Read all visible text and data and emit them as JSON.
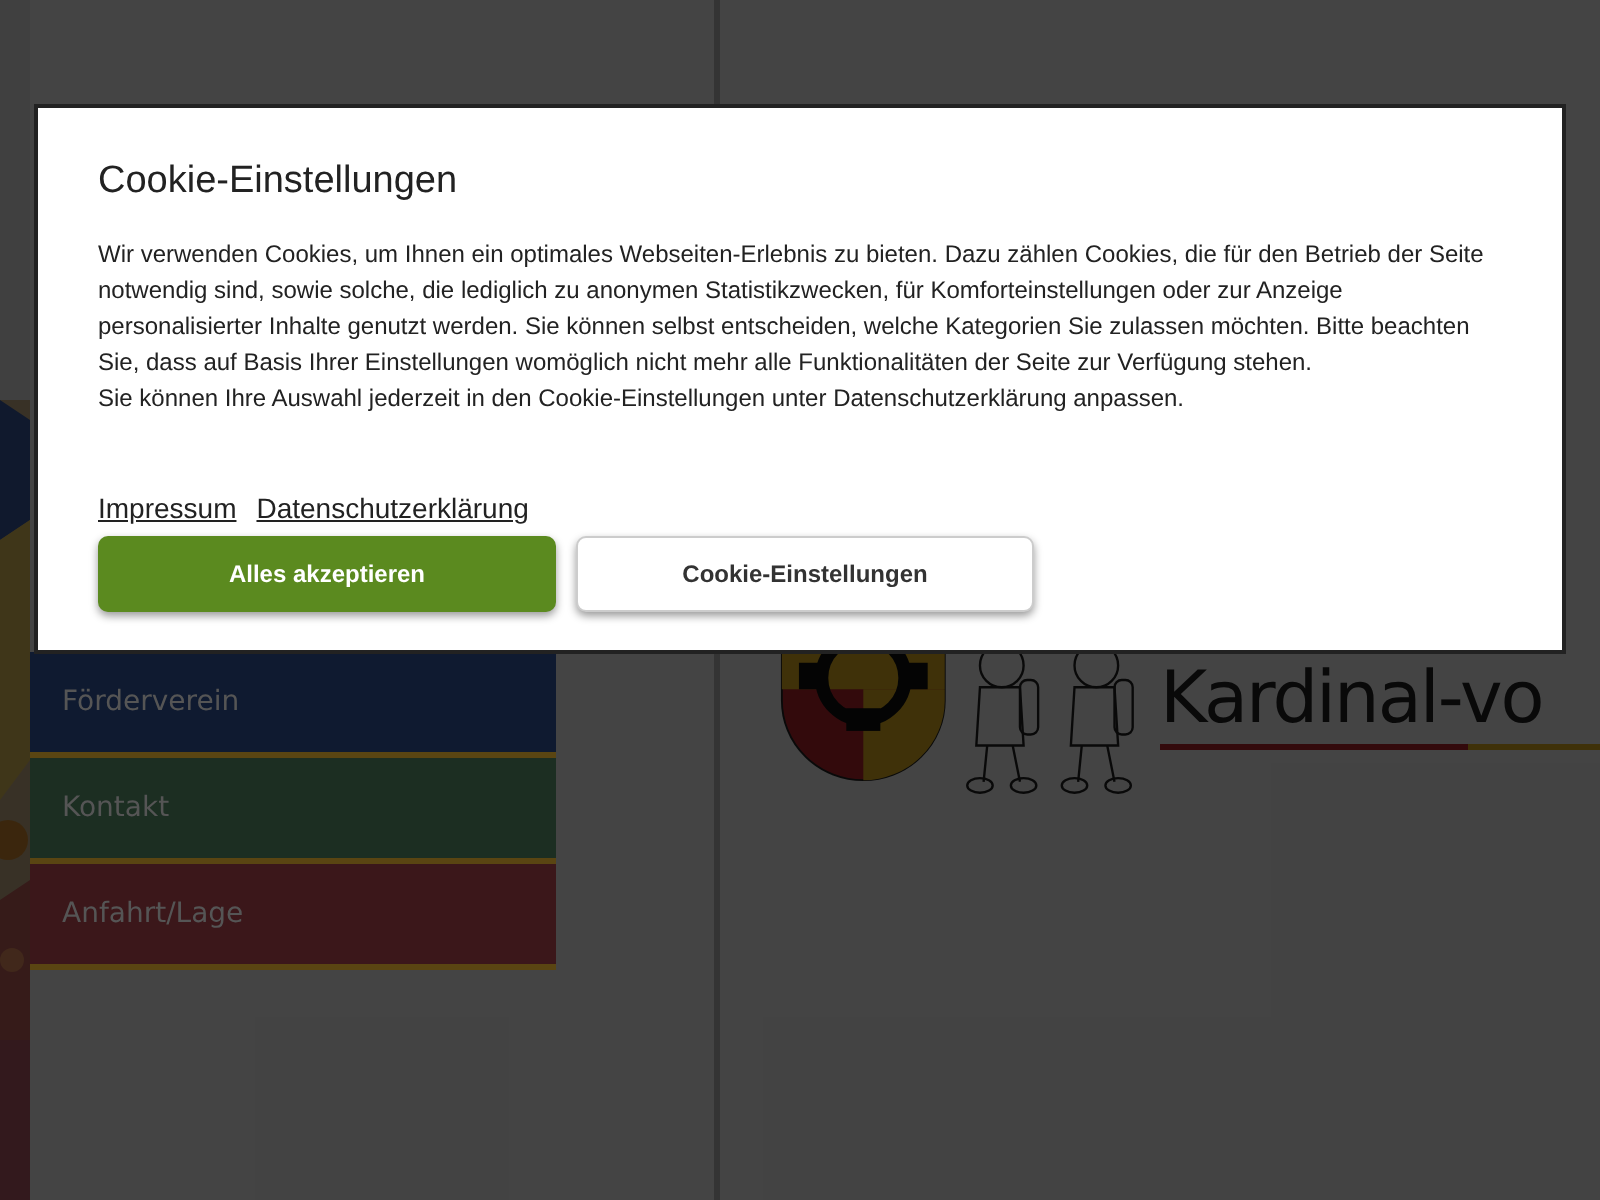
{
  "nav": {
    "items": [
      {
        "label": "Förderverein",
        "color": "#0f1a30"
      },
      {
        "label": "Kontakt",
        "color": "#1c2e22"
      },
      {
        "label": "Anfahrt/Lage",
        "color": "#3b171a"
      }
    ]
  },
  "logo": {
    "text": "Kardinal-vo"
  },
  "cookie_dialog": {
    "title": "Cookie-Einstellungen",
    "paragraphs": [
      "Wir verwenden Cookies, um Ihnen ein optimales Webseiten-Erlebnis zu bieten. Dazu zählen Cookies, die für den Betrieb der Seite notwendig sind, sowie solche, die lediglich zu anonymen Statistikzwecken, für Komforteinstellungen oder zur Anzeige personalisierter Inhalte genutzt werden. Sie können selbst entscheiden, welche Kategorien Sie zulassen möchten. Bitte beachten Sie, dass auf Basis Ihrer Einstellungen womöglich nicht mehr alle Funktionalitäten der Seite zur Verfügung stehen.",
      "Sie können Ihre Auswahl jederzeit in den Cookie-Einstellungen unter Datenschutzerklärung anpassen."
    ],
    "links": [
      "Impressum",
      "Datenschutzerklärung"
    ],
    "buttons": [
      {
        "label": "Alles akzeptieren",
        "kind": "primary"
      },
      {
        "label": "Cookie-Einstellungen",
        "kind": "secondary"
      }
    ]
  }
}
